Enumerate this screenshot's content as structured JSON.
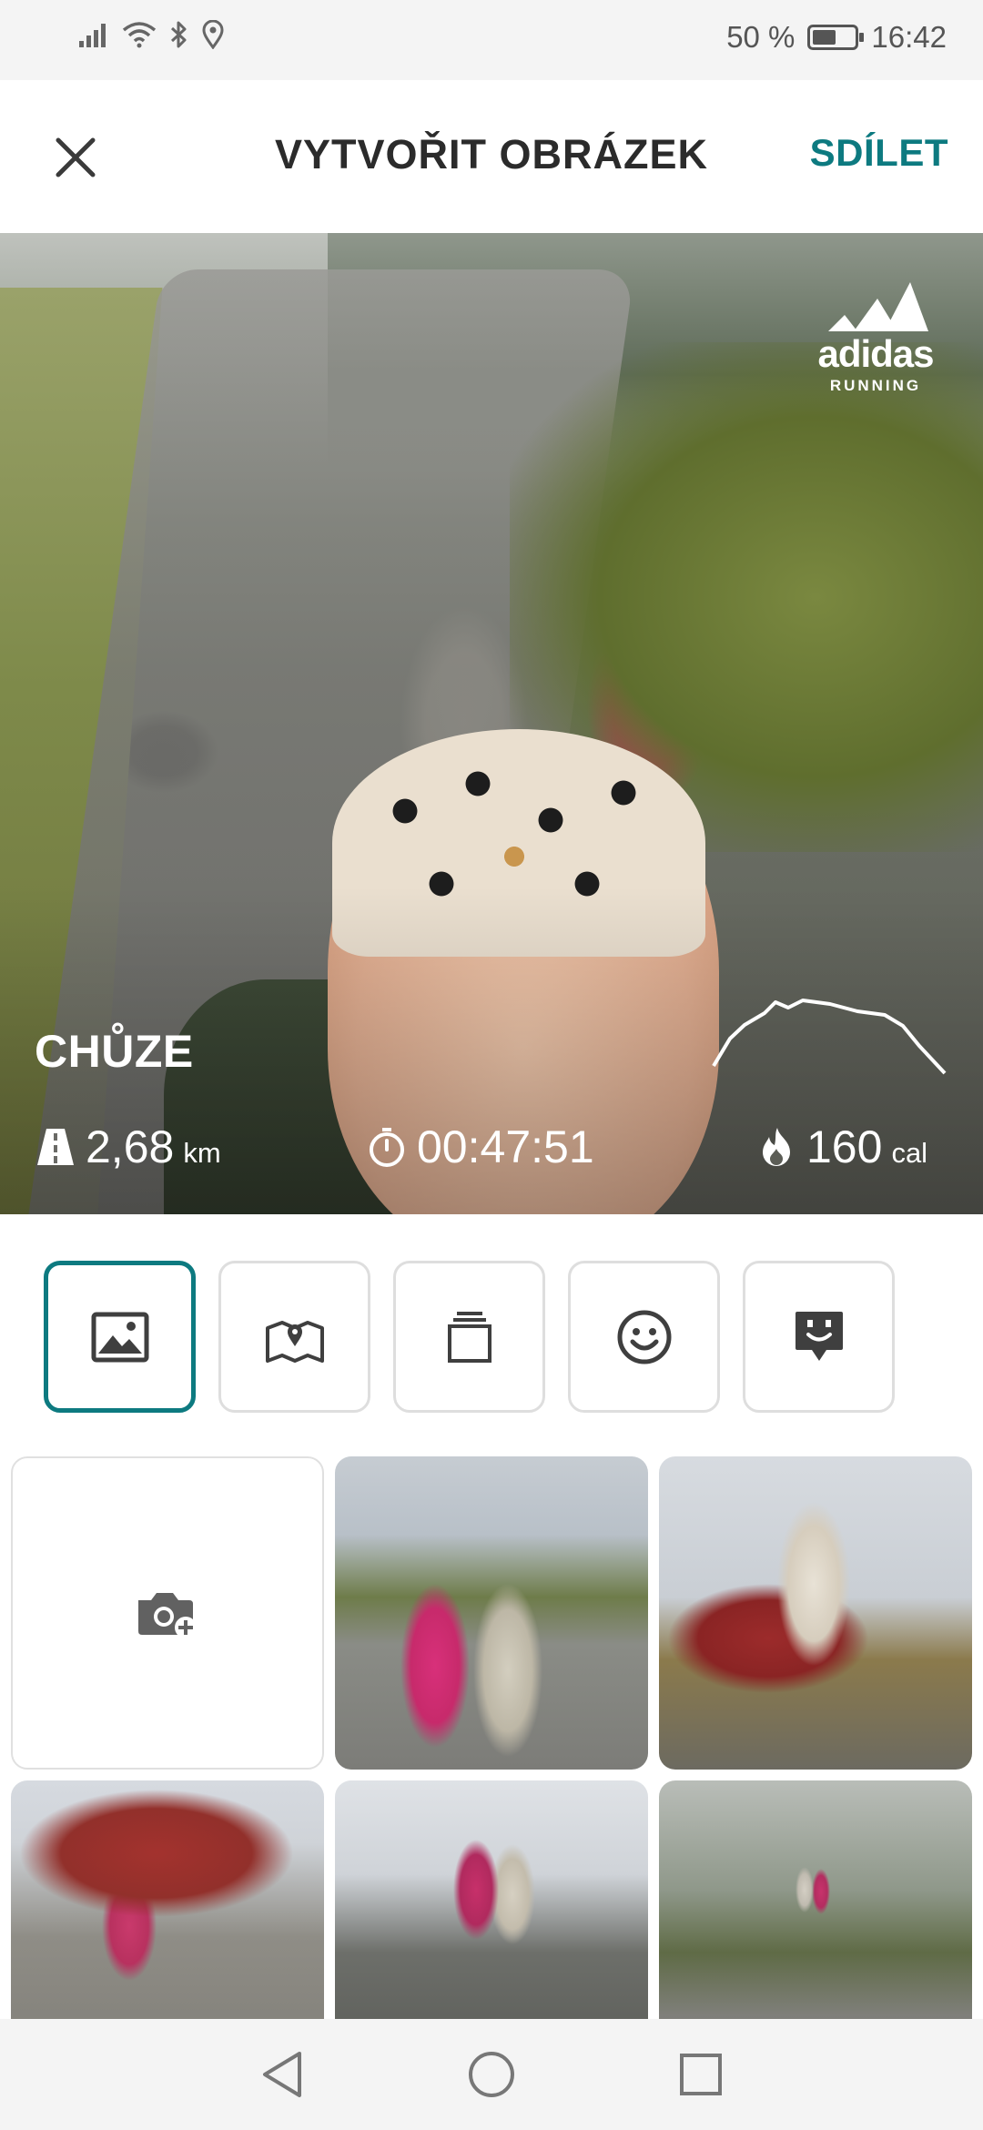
{
  "status_bar": {
    "battery_text": "50 %",
    "battery_level": 0.5,
    "time": "16:42",
    "icons": [
      "signal-icon",
      "wifi-icon",
      "bluetooth-icon",
      "location-icon",
      "battery-icon"
    ]
  },
  "header": {
    "close_icon": "close-icon",
    "title": "VYTVOŘIT OBRÁZEK",
    "share_label": "SDÍLET"
  },
  "hero": {
    "brand_name": "adidas",
    "brand_sub": "RUNNING",
    "activity_title": "CHŮZE",
    "stats": {
      "distance_value": "2,68",
      "distance_unit": "km",
      "duration_value": "00:47:51",
      "calories_value": "160",
      "calories_unit": "cal"
    }
  },
  "tools": [
    {
      "icon": "image-icon",
      "selected": true
    },
    {
      "icon": "map-icon",
      "selected": false
    },
    {
      "icon": "layers-icon",
      "selected": false
    },
    {
      "icon": "smiley-icon",
      "selected": false
    },
    {
      "icon": "sticker-icon",
      "selected": false
    }
  ],
  "gallery": {
    "add_photo_icon": "camera-add-icon",
    "photo_count": 5
  },
  "colors": {
    "accent": "#0d7a80",
    "text_dark": "#2b2b2b",
    "tool_border": "#dedede"
  },
  "nav_bar": {
    "icons": [
      "back-icon",
      "home-icon",
      "recents-icon"
    ]
  }
}
